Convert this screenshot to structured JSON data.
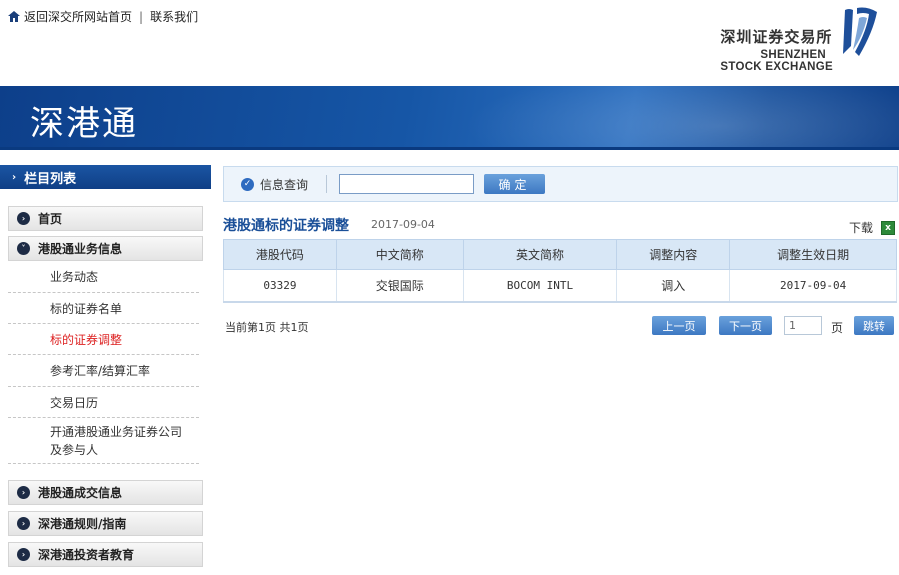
{
  "toplinks": {
    "home_label": "返回深交所网站首页",
    "sep": "|",
    "contact_label": "联系我们"
  },
  "logo": {
    "cn": "深圳证券交易所",
    "en_line1": "SHENZHEN",
    "en_line2": "STOCK EXCHANGE"
  },
  "banner": {
    "title": "深港通"
  },
  "sidebar": {
    "header": "栏目列表",
    "categories": [
      {
        "label": "首页"
      },
      {
        "label": "港股通业务信息"
      }
    ],
    "subitems": [
      {
        "label": "业务动态"
      },
      {
        "label": "标的证券名单"
      },
      {
        "label": "标的证券调整"
      },
      {
        "label": "参考汇率/结算汇率"
      },
      {
        "label": "交易日历"
      },
      {
        "label_line1": "开通港股通业务证券公司",
        "label_line2": "及参与人"
      }
    ],
    "bottom_categories": [
      {
        "label": "港股通成交信息"
      },
      {
        "label": "深港通规则/指南"
      },
      {
        "label": "深港通投资者教育"
      }
    ],
    "active_color": "#dd2222"
  },
  "search": {
    "label": "信息查询",
    "value": "",
    "button": "确定"
  },
  "section": {
    "title": "港股通标的证券调整",
    "date": "2017-09-04",
    "download_label": "下载"
  },
  "table": {
    "headers": [
      "港股代码",
      "中文简称",
      "英文简称",
      "调整内容",
      "调整生效日期"
    ],
    "rows": [
      [
        "03329",
        "交银国际",
        "BOCOM INTL",
        "调入",
        "2017-09-04"
      ]
    ]
  },
  "pager": {
    "info": "当前第1页 共1页",
    "prev": "上一页",
    "next": "下一页",
    "page_value": "1",
    "page_label": "页",
    "jump": "跳转"
  }
}
